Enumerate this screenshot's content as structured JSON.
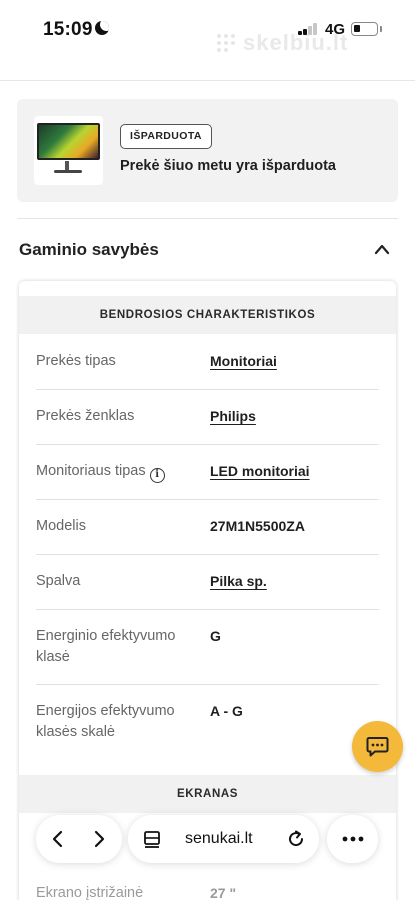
{
  "status_bar": {
    "time": "15:09",
    "network": "4G",
    "watermark": "skelbiu.lt"
  },
  "soldout": {
    "badge": "IŠPARDUOTA",
    "message": "Prekė šiuo metu yra išparduota"
  },
  "features": {
    "title": "Gaminio savybės",
    "sections": [
      {
        "heading": "BENDROSIOS CHARAKTERISTIKOS",
        "rows": [
          {
            "label": "Prekės tipas",
            "value": "Monitoriai",
            "link": true
          },
          {
            "label": "Prekės ženklas",
            "value": "Philips",
            "link": true
          },
          {
            "label": "Monitoriaus tipas",
            "value": "LED monitoriai",
            "link": true,
            "info": true
          },
          {
            "label": "Modelis",
            "value": "27M1N5500ZA",
            "link": false
          },
          {
            "label": "Spalva",
            "value": "Pilka sp.",
            "link": true
          },
          {
            "label": "Energinio efektyvumo klasė",
            "value": "G",
            "link": false
          },
          {
            "label": "Energijos efektyvumo klasės skalė",
            "value": "A - G",
            "link": false
          }
        ]
      },
      {
        "heading": "EKRANAS",
        "rows": [
          {
            "label": "Ekrano įstrižainė",
            "value": "27 \"",
            "link": false
          }
        ]
      }
    ]
  },
  "browser": {
    "url": "senukai.lt"
  },
  "colors": {
    "fab": "#f4b83a",
    "card_bg": "#f2f2f2",
    "section_header_bg": "#f1f1f1"
  },
  "icons": [
    "moon-icon",
    "signal-icon",
    "battery-icon",
    "chevron-up-icon",
    "info-icon",
    "chat-icon",
    "back-icon",
    "forward-icon",
    "reader-icon",
    "reload-icon",
    "more-icon"
  ]
}
